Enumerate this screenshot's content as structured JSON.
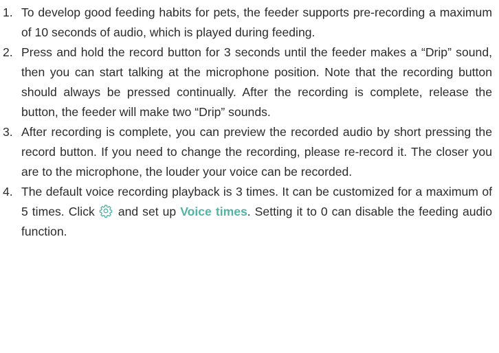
{
  "steps": [
    {
      "number": "1.",
      "text": "To develop good feeding habits for pets, the feeder supports pre-recording a maximum of 10 seconds of audio, which is played during feeding."
    },
    {
      "number": "2.",
      "text": "Press and hold the record button for 3 seconds until the feeder makes a “Drip” sound, then you can start talking at the microphone position. Note that the recording button should always be pressed continually. After the recording is complete, release the button, the feeder will make two “Drip” sounds."
    },
    {
      "number": "3.",
      "text": "After recording is complete, you can preview the recorded audio by short pressing the record button. If you need to change the recording, please re-record it. The closer you are to the microphone, the louder your voice can be recorded."
    },
    {
      "number": "4.",
      "text_before": "The default voice recording playback is 3 times. It can be customized for a maximum of 5 times. Click",
      "icon": "gear-icon",
      "text_middle": "and set up",
      "highlight": "Voice times",
      "text_after": ". Setting it to 0 can disable the feeding audio function."
    }
  ],
  "colors": {
    "text": "#2b2b2b",
    "accent": "#4fb3a6"
  }
}
